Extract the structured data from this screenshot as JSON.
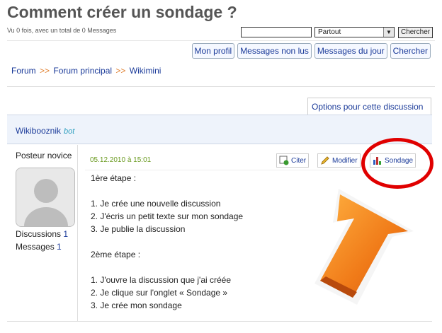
{
  "page": {
    "title": "Comment créer un sondage ?",
    "views": "Vu 0 fois, avec un total de 0 Messages"
  },
  "search": {
    "value": "",
    "scope": "Partout",
    "button": "Chercher"
  },
  "nav": [
    "Mon profil",
    "Messages non lus",
    "Messages du jour",
    "Chercher"
  ],
  "breadcrumb": {
    "items": [
      "Forum",
      "Forum principal",
      "Wikimini"
    ],
    "separator": ">>"
  },
  "options_label": "Options pour cette discussion",
  "post": {
    "author": "Wikibooznik",
    "author_tag": "bot",
    "rank": "Posteur novice",
    "stats": {
      "discussions_label": "Discussions",
      "discussions": "1",
      "messages_label": "Messages",
      "messages": "1"
    },
    "date": "05.12.2010 à 15:01",
    "actions": {
      "quote": "Citer",
      "edit": "Modifier",
      "poll": "Sondage"
    },
    "lines": [
      "1ère étape :",
      "",
      "1. Je crée une nouvelle discussion",
      "2. J'écris un petit texte sur mon sondage",
      "3. Je publie la discussion",
      "",
      "2ème étape :",
      "",
      "1. J'ouvre la discussion que j'ai créée",
      "2. Je clique sur l'onglet « Sondage »",
      "3. Je crée mon sondage"
    ]
  },
  "colors": {
    "link": "#1a3a99",
    "highlight": "#e00000",
    "arrow": "#f08020"
  }
}
